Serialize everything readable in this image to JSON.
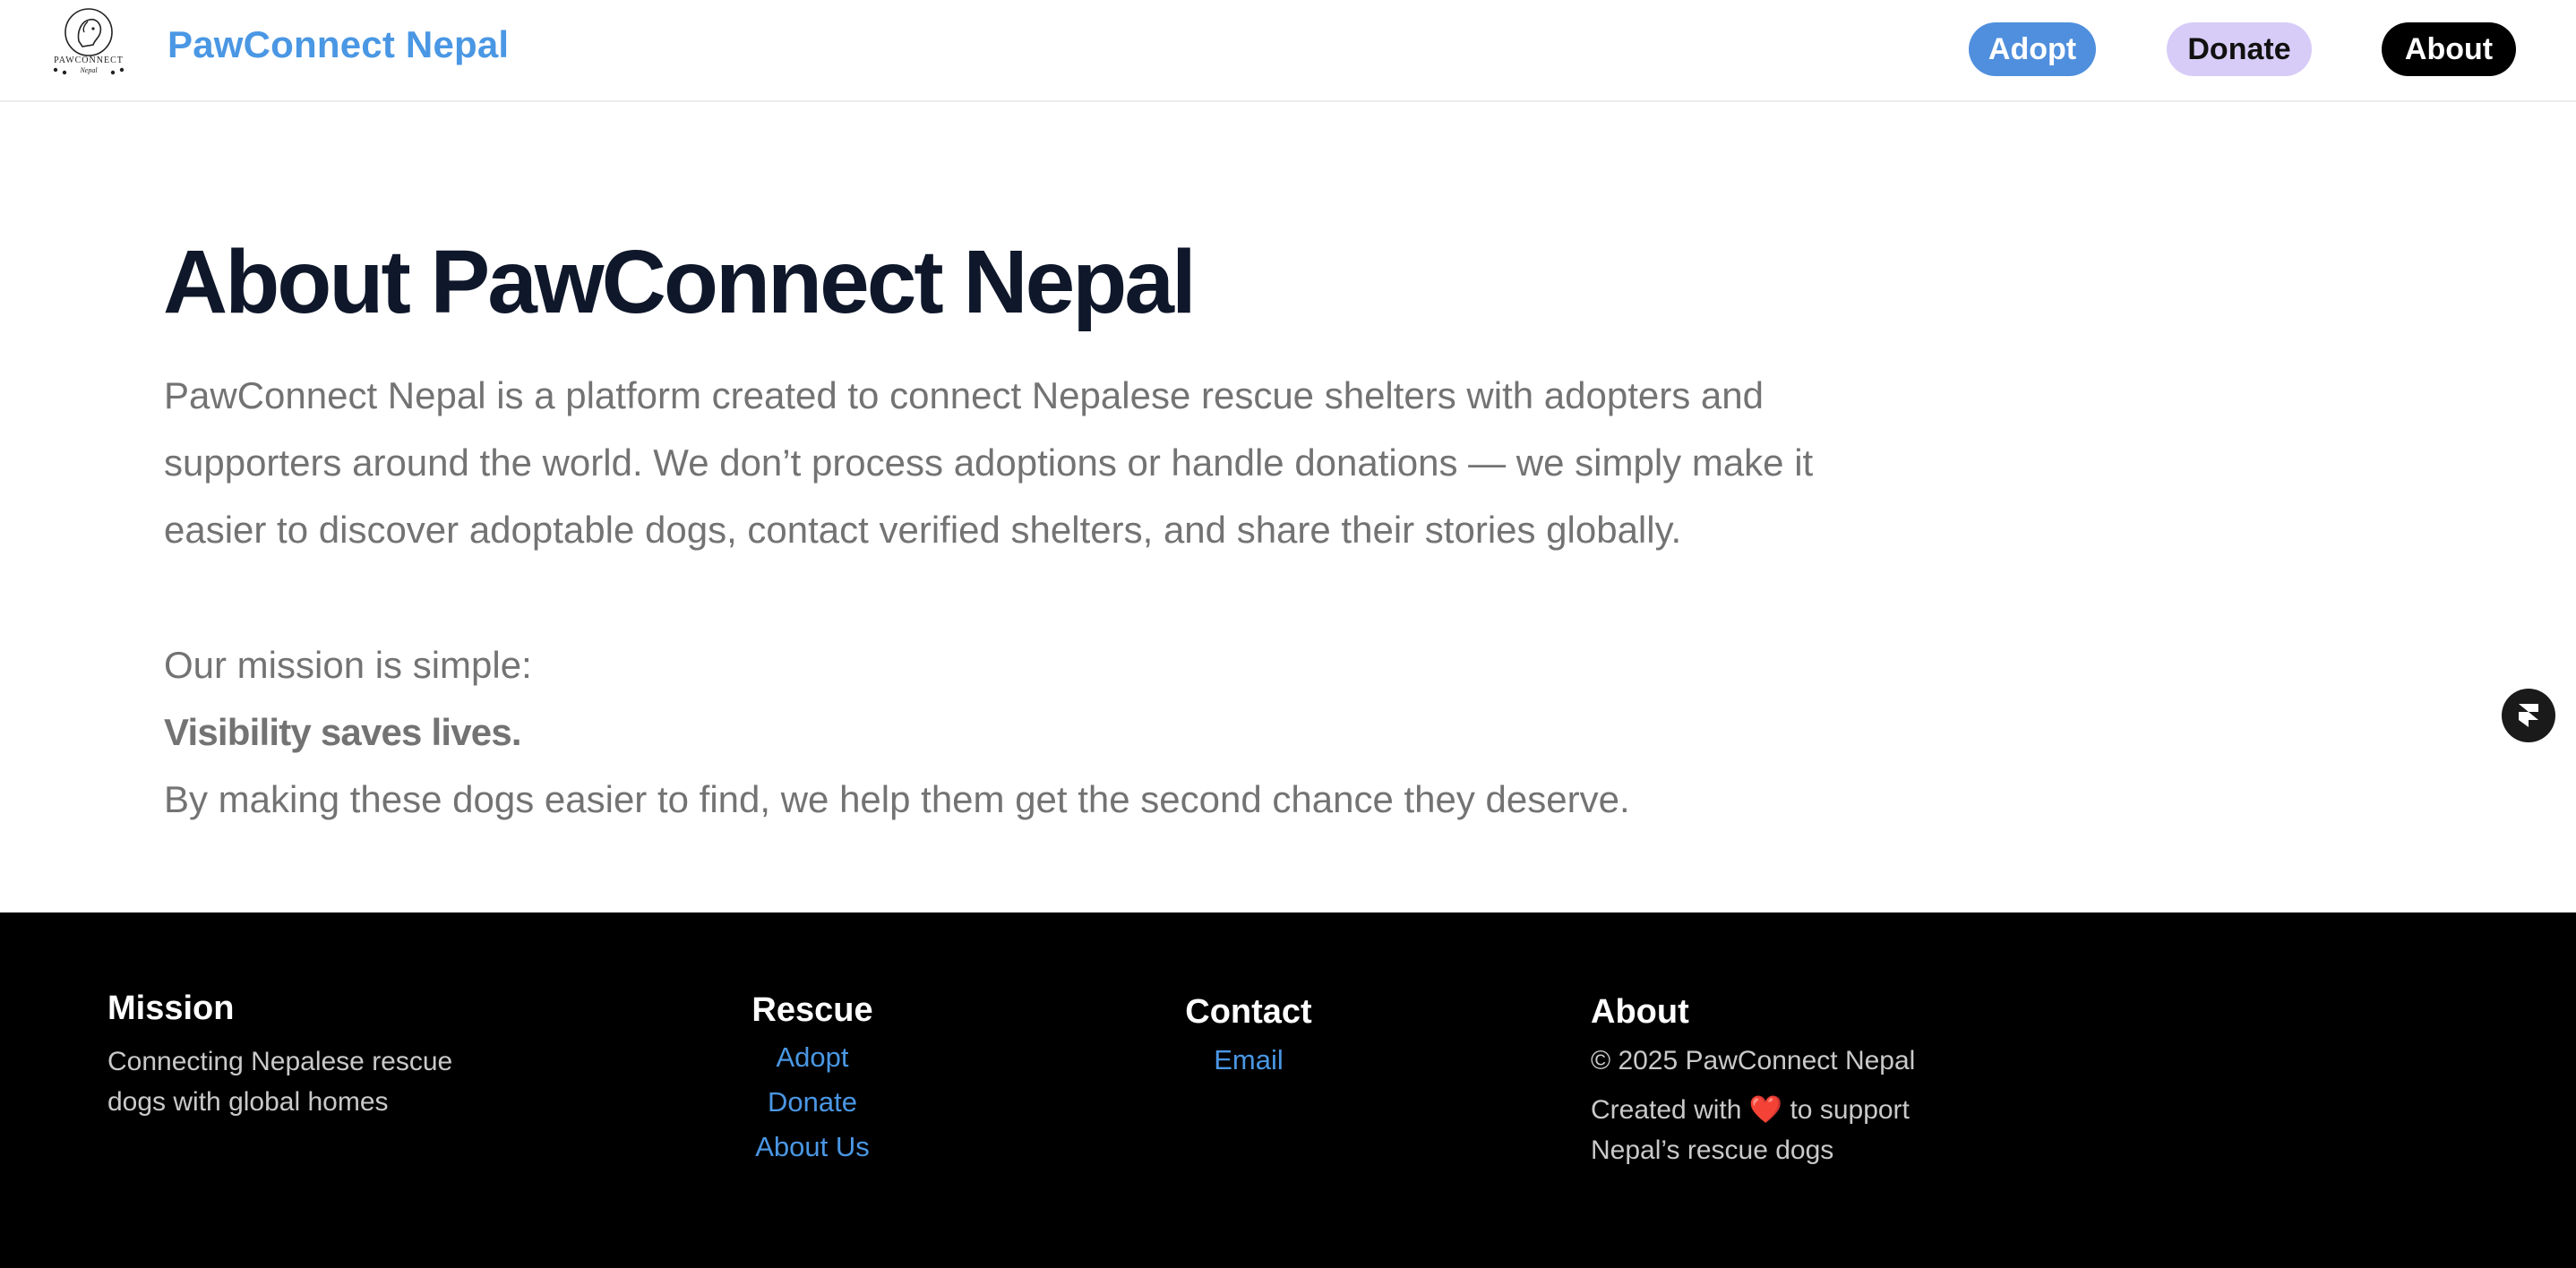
{
  "header": {
    "logo_alt": "PawConnect Nepal",
    "logo_text": "PAWCONNECT",
    "logo_subtext": "Nepal",
    "brand": "PawConnect Nepal",
    "nav": {
      "adopt": "Adopt",
      "donate": "Donate",
      "about": "About"
    }
  },
  "main": {
    "title": "About PawConnect Nepal",
    "intro": "PawConnect Nepal is a platform created to connect Nepalese rescue shelters with adopters and supporters around the world. We don’t process adoptions or handle donations — we simply make it easier to discover adoptable dogs, contact verified shelters, and share their stories globally.",
    "mission_lead": "Our mission is simple:",
    "mission_bold": "Visibility saves lives.",
    "mission_tail": "By making these dogs easier to find, we help them get the second chance they deserve."
  },
  "footer": {
    "mission": {
      "heading": "Mission",
      "text": "Connecting Nepalese rescue dogs with global homes"
    },
    "rescue": {
      "heading": "Rescue",
      "links": [
        "Adopt",
        "Donate",
        "About Us"
      ]
    },
    "contact": {
      "heading": "Contact",
      "email": "Email"
    },
    "about": {
      "heading": "About",
      "copyright": "© 2025 PawConnect Nepal",
      "created_pre": "Created with",
      "heart": "❤️",
      "created_post": "to support Nepal’s rescue dogs"
    }
  },
  "colors": {
    "brand_blue": "#4a97e4",
    "adopt_bg": "#4f8fdd",
    "donate_bg": "#d7ccf7",
    "about_bg": "#000000",
    "title": "#0f172a",
    "body_text": "#737373",
    "footer_bg": "#000000"
  },
  "icons": {
    "logo": "dog-logo-icon",
    "floating_badge": "framer-icon"
  }
}
